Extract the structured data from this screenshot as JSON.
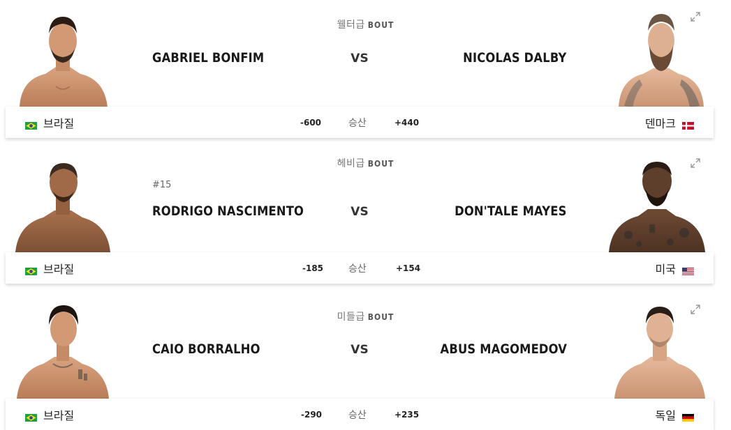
{
  "bouts": [
    {
      "weight_class": "웰터급",
      "bout_word": "BOUT",
      "rank": "",
      "red": {
        "name": "GABRIEL BONFIM",
        "country": "브라질",
        "odds": "-600",
        "flag": "brazil-flag"
      },
      "blue": {
        "name": "NICOLAS DALBY",
        "country": "덴마크",
        "odds": "+440",
        "flag": "denmark-flag"
      },
      "vs": "VS",
      "result_label": "승산"
    },
    {
      "weight_class": "헤비급",
      "bout_word": "BOUT",
      "rank": "#15",
      "red": {
        "name": "RODRIGO NASCIMENTO",
        "country": "브라질",
        "odds": "-185",
        "flag": "brazil-flag"
      },
      "blue": {
        "name": "DON'TALE MAYES",
        "country": "미국",
        "odds": "+154",
        "flag": "usa-flag"
      },
      "vs": "VS",
      "result_label": "승산"
    },
    {
      "weight_class": "미들급",
      "bout_word": "BOUT",
      "rank": "",
      "red": {
        "name": "CAIO BORRALHO",
        "country": "브라질",
        "odds": "-290",
        "flag": "brazil-flag"
      },
      "blue": {
        "name": "ABUS MAGOMEDOV",
        "country": "독일",
        "odds": "+235",
        "flag": "germany-flag"
      },
      "vs": "VS",
      "result_label": "승산"
    }
  ],
  "colors": {
    "text": "#191919",
    "muted": "#777777",
    "shadow": "#d9d9d9"
  }
}
